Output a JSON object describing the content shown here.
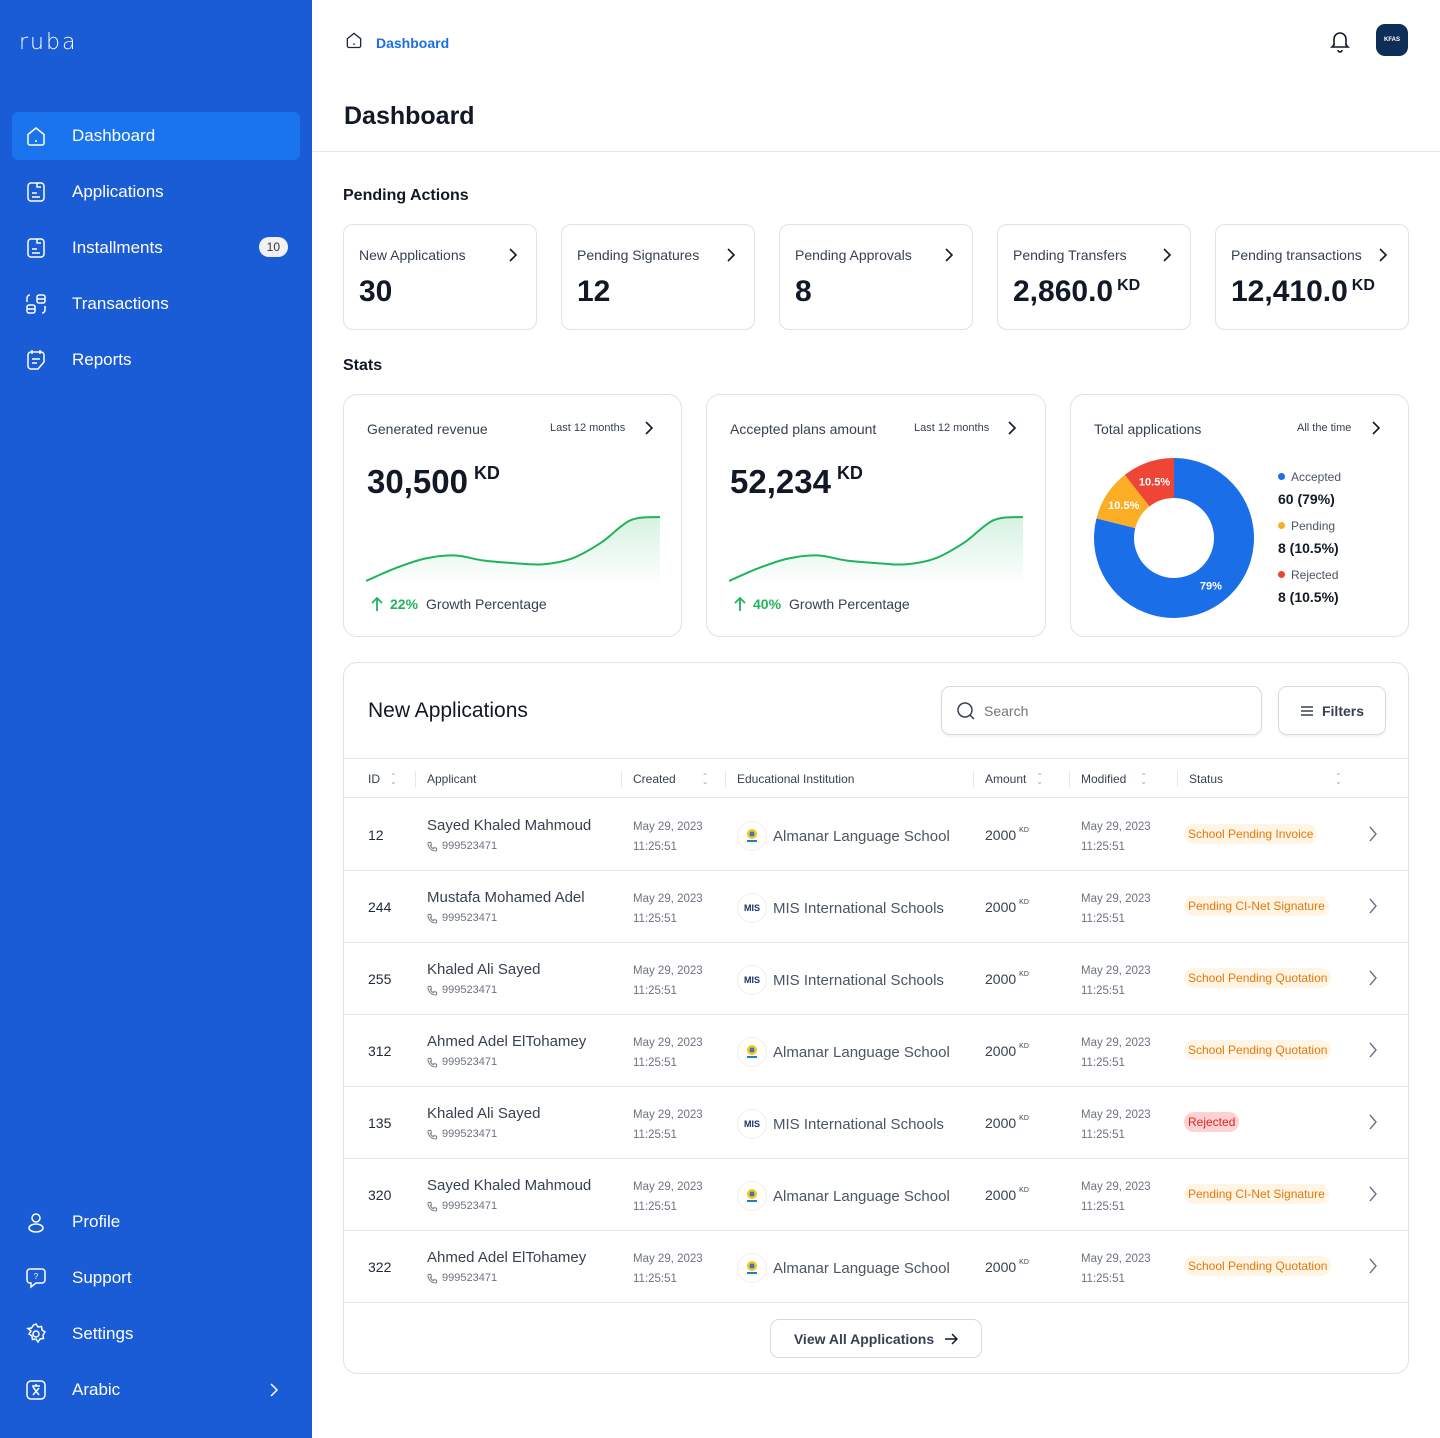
{
  "brand": {
    "logo_text": "ruba"
  },
  "sidebar": {
    "items": [
      {
        "label": "Dashboard",
        "icon": "home-icon",
        "active": true
      },
      {
        "label": "Applications",
        "icon": "document-icon"
      },
      {
        "label": "Installments",
        "icon": "document-icon",
        "badge": "10"
      },
      {
        "label": "Transactions",
        "icon": "transactions-icon"
      },
      {
        "label": "Reports",
        "icon": "report-icon"
      }
    ],
    "bottom_items": [
      {
        "label": "Profile",
        "icon": "user-icon"
      },
      {
        "label": "Support",
        "icon": "help-chat-icon"
      },
      {
        "label": "Settings",
        "icon": "gear-icon"
      },
      {
        "label": "Arabic",
        "icon": "language-icon"
      }
    ]
  },
  "header": {
    "breadcrumb": "Dashboard",
    "page_title": "Dashboard",
    "avatar_text": "KFAS"
  },
  "pending_actions": {
    "title": "Pending Actions",
    "cards": [
      {
        "label": "New Applications",
        "value": "30",
        "unit": ""
      },
      {
        "label": "Pending Signatures",
        "value": "12",
        "unit": ""
      },
      {
        "label": "Pending Approvals",
        "value": "8",
        "unit": ""
      },
      {
        "label": "Pending Transfers",
        "value": "2,860.0",
        "unit": "KD"
      },
      {
        "label": "Pending transactions",
        "value": "12,410.0",
        "unit": "KD"
      }
    ]
  },
  "stats": {
    "title": "Stats",
    "revenue": {
      "title": "Generated revenue",
      "period": "Last 12 months",
      "value": "30,500",
      "unit": "KD",
      "growth_pct": "22%",
      "growth_label": "Growth Percentage"
    },
    "accepted": {
      "title": "Accepted plans amount",
      "period": "Last 12 months",
      "value": "52,234",
      "unit": "KD",
      "growth_pct": "40%",
      "growth_label": "Growth Percentage"
    },
    "total": {
      "title": "Total applications",
      "period": "All the time",
      "legend": [
        {
          "label": "Accepted",
          "value": "60 (79%)",
          "color": "#1a6fe8"
        },
        {
          "label": "Pending",
          "value": "8 (10.5%)",
          "color": "#fbad25"
        },
        {
          "label": "Rejected",
          "value": "8 (10.5%)",
          "color": "#ef4536"
        }
      ]
    }
  },
  "chart_data": [
    {
      "type": "line",
      "title": "Generated revenue",
      "series": [
        {
          "name": "revenue trend",
          "values": [
            0,
            0.2,
            0.35,
            0.4,
            0.32,
            0.28,
            0.26,
            0.35,
            0.6,
            0.95,
            1.0
          ]
        }
      ],
      "color": "#1fb35c"
    },
    {
      "type": "line",
      "title": "Accepted plans amount",
      "series": [
        {
          "name": "accepted trend",
          "values": [
            0,
            0.2,
            0.35,
            0.4,
            0.32,
            0.28,
            0.26,
            0.35,
            0.6,
            0.95,
            1.0
          ]
        }
      ],
      "color": "#1fb35c"
    },
    {
      "type": "pie",
      "title": "Total applications",
      "categories": [
        "Accepted",
        "Pending",
        "Rejected"
      ],
      "values": [
        60,
        8,
        8
      ],
      "labels": [
        "79%",
        "10.5%",
        "10.5%"
      ],
      "colors": [
        "#1a6fe8",
        "#fbad25",
        "#ef4536"
      ]
    }
  ],
  "applications": {
    "title": "New Applications",
    "search_placeholder": "Search",
    "filters_label": "Filters",
    "columns": [
      "ID",
      "Applicant",
      "Created",
      "Educational Institution",
      "Amount",
      "Modified",
      "Status"
    ],
    "rows": [
      {
        "id": "12",
        "name": "Sayed Khaled Mahmoud",
        "phone": "999523471",
        "created_date": "May 29, 2023",
        "created_time": "11:25:51",
        "institution": "Almanar Language School",
        "logo": "almanar",
        "amount": "2000",
        "unit": "KD",
        "modified_date": "May 29, 2023",
        "modified_time": "11:25:51",
        "status": "School Pending Invoice",
        "status_type": "warn"
      },
      {
        "id": "244",
        "name": "Mustafa Mohamed Adel",
        "phone": "999523471",
        "created_date": "May 29, 2023",
        "created_time": "11:25:51",
        "institution": "MIS International Schools",
        "logo": "mis",
        "amount": "2000",
        "unit": "KD",
        "modified_date": "May 29, 2023",
        "modified_time": "11:25:51",
        "status": "Pending CI-Net Signature",
        "status_type": "warn"
      },
      {
        "id": "255",
        "name": "Khaled Ali Sayed",
        "phone": "999523471",
        "created_date": "May 29, 2023",
        "created_time": "11:25:51",
        "institution": "MIS International Schools",
        "logo": "mis",
        "amount": "2000",
        "unit": "KD",
        "modified_date": "May 29, 2023",
        "modified_time": "11:25:51",
        "status": "School Pending Quotation",
        "status_type": "warn"
      },
      {
        "id": "312",
        "name": "Ahmed Adel ElTohamey",
        "phone": "999523471",
        "created_date": "May 29, 2023",
        "created_time": "11:25:51",
        "institution": "Almanar Language School",
        "logo": "almanar",
        "amount": "2000",
        "unit": "KD",
        "modified_date": "May 29, 2023",
        "modified_time": "11:25:51",
        "status": "School Pending Quotation",
        "status_type": "warn"
      },
      {
        "id": "135",
        "name": "Khaled Ali Sayed",
        "phone": "999523471",
        "created_date": "May 29, 2023",
        "created_time": "11:25:51",
        "institution": "MIS International Schools",
        "logo": "mis",
        "amount": "2000",
        "unit": "KD",
        "modified_date": "May 29, 2023",
        "modified_time": "11:25:51",
        "status": "Rejected",
        "status_type": "rej"
      },
      {
        "id": "320",
        "name": "Sayed Khaled Mahmoud",
        "phone": "999523471",
        "created_date": "May 29, 2023",
        "created_time": "11:25:51",
        "institution": "Almanar Language School",
        "logo": "almanar",
        "amount": "2000",
        "unit": "KD",
        "modified_date": "May 29, 2023",
        "modified_time": "11:25:51",
        "status": "Pending CI-Net Signature",
        "status_type": "warn"
      },
      {
        "id": "322",
        "name": "Ahmed Adel ElTohamey",
        "phone": "999523471",
        "created_date": "May 29, 2023",
        "created_time": "11:25:51",
        "institution": "Almanar Language School",
        "logo": "almanar",
        "amount": "2000",
        "unit": "KD",
        "modified_date": "May 29, 2023",
        "modified_time": "11:25:51",
        "status": "School Pending Quotation",
        "status_type": "warn"
      }
    ],
    "view_all_label": "View All Applications"
  }
}
